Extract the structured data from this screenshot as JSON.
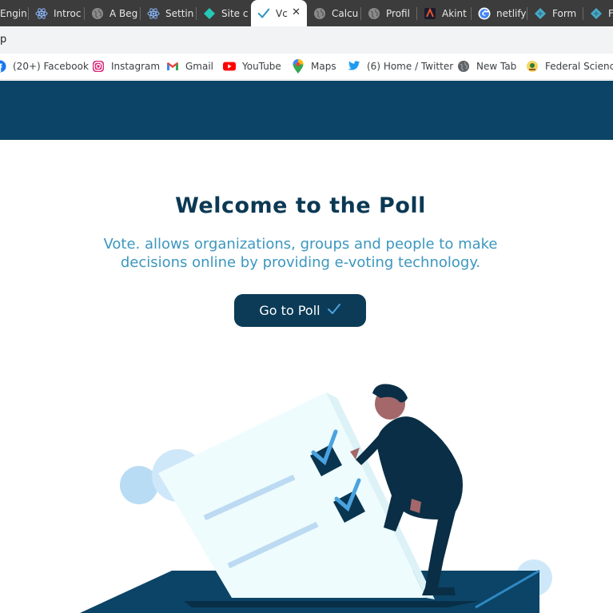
{
  "browser": {
    "tabs": [
      {
        "title": "Engin",
        "icon": "engine-favicon",
        "active": false
      },
      {
        "title": "Introc",
        "icon": "react-icon",
        "active": false
      },
      {
        "title": "A Beg",
        "icon": "globe-icon",
        "active": false
      },
      {
        "title": "Settin",
        "icon": "react-icon",
        "active": false
      },
      {
        "title": "Site c",
        "icon": "netlify-icon",
        "active": false
      },
      {
        "title": "Vc",
        "icon": "checkmark-icon",
        "active": true
      },
      {
        "title": "Calcu",
        "icon": "globe-icon",
        "active": false
      },
      {
        "title": "Profil",
        "icon": "globe-icon",
        "active": false
      },
      {
        "title": "Akint",
        "icon": "akint-icon",
        "active": false
      },
      {
        "title": "netlify",
        "icon": "google-icon",
        "active": false
      },
      {
        "title": "Form",
        "icon": "netlify-icon",
        "active": false
      },
      {
        "title": "Fo",
        "icon": "netlify-icon",
        "active": false
      }
    ],
    "address": "p",
    "bookmarks": [
      {
        "label": "(20+) Facebook",
        "icon": "facebook-icon"
      },
      {
        "label": "Instagram",
        "icon": "instagram-icon"
      },
      {
        "label": "Gmail",
        "icon": "gmail-icon"
      },
      {
        "label": "YouTube",
        "icon": "youtube-icon"
      },
      {
        "label": "Maps",
        "icon": "maps-icon"
      },
      {
        "label": "(6) Home / Twitter",
        "icon": "twitter-icon"
      },
      {
        "label": "New Tab",
        "icon": "globe-icon"
      },
      {
        "label": "Federal Science",
        "icon": "federal-science-icon"
      }
    ]
  },
  "hero": {
    "title": "Welcome to the Poll",
    "subtitle": "Vote. allows organizations, groups and people to make decisions online by providing e-voting technology.",
    "cta_label": "Go to Poll"
  },
  "colors": {
    "header": "#0b4466",
    "title": "#0b3954",
    "subtitle": "#3c97bf",
    "button": "#0b3b57",
    "check": "#4aa3df"
  }
}
